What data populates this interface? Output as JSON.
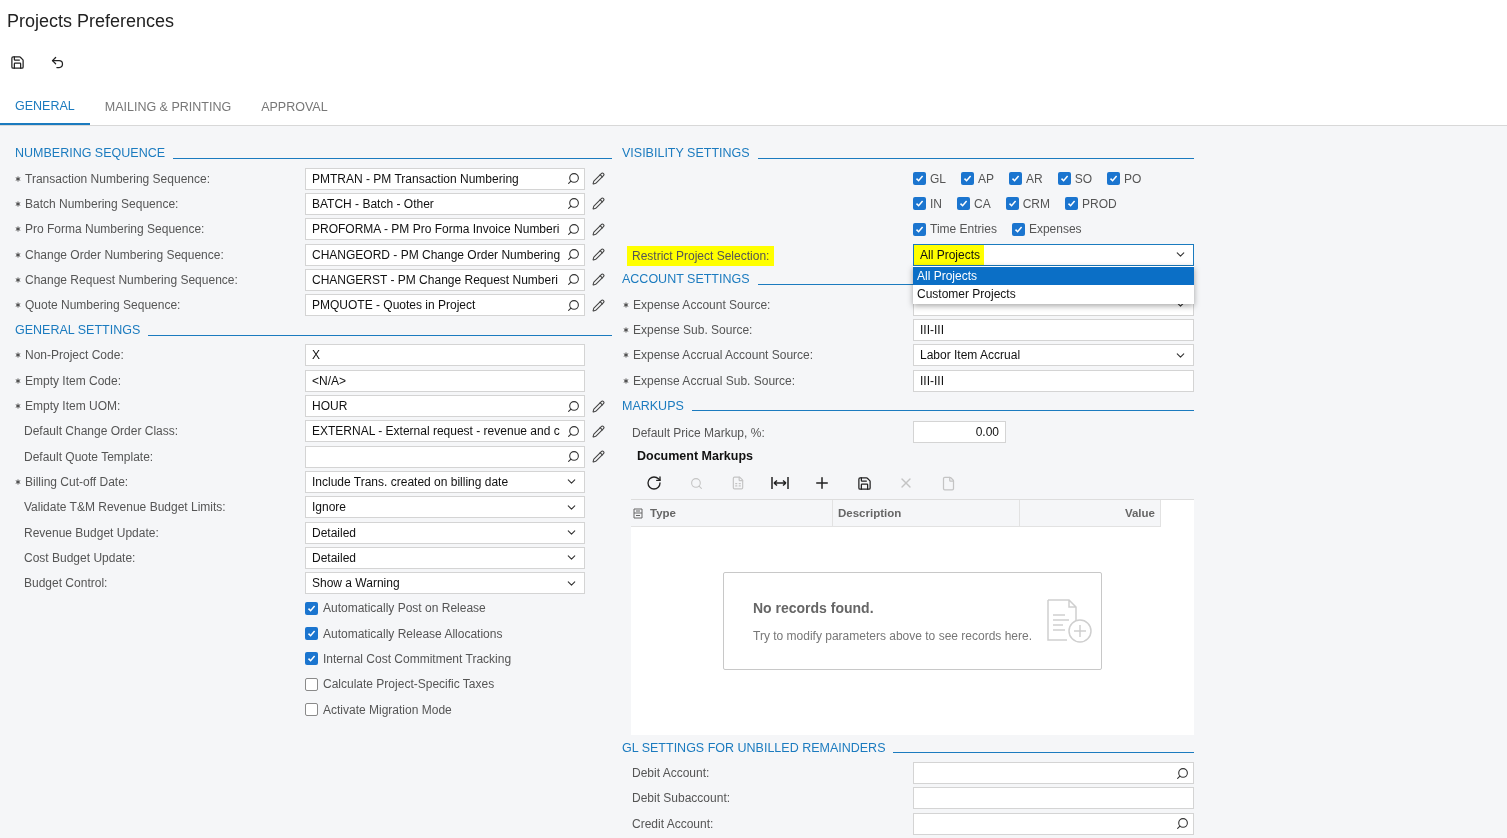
{
  "title": "Projects Preferences",
  "toolbar": [
    {
      "kind": "save"
    },
    {
      "kind": "undo"
    }
  ],
  "tabs": [
    {
      "label": "GENERAL",
      "selected": true
    },
    {
      "label": "MAILING & PRINTING",
      "selected": false
    },
    {
      "label": "APPROVAL",
      "selected": false
    }
  ],
  "left_sections": [
    {
      "title": "NUMBERING SEQUENCE",
      "rows": [
        {
          "kind": "lookup",
          "label": "Transaction Numbering Sequence:",
          "required": true,
          "value": "PMTRAN - PM Transaction Numbering",
          "editable": true
        },
        {
          "kind": "lookup",
          "label": "Batch Numbering Sequence:",
          "required": true,
          "value": "BATCH - Batch - Other",
          "editable": true
        },
        {
          "kind": "lookup",
          "label": "Pro Forma Numbering Sequence:",
          "required": true,
          "value": "PROFORMA - PM Pro Forma Invoice Numberi",
          "editable": true
        },
        {
          "kind": "lookup",
          "label": "Change Order Numbering Sequence:",
          "required": true,
          "value": "CHANGEORD - PM Change Order Numbering",
          "editable": true
        },
        {
          "kind": "lookup",
          "label": "Change Request Numbering Sequence:",
          "required": true,
          "value": "CHANGERST - PM Change Request Numberi",
          "editable": true
        },
        {
          "kind": "lookup",
          "label": "Quote Numbering Sequence:",
          "required": true,
          "value": "PMQUOTE - Quotes in Project",
          "editable": true
        }
      ]
    },
    {
      "title": "GENERAL SETTINGS",
      "rows": [
        {
          "kind": "text",
          "label": "Non-Project Code:",
          "required": true,
          "value": "X"
        },
        {
          "kind": "text",
          "label": "Empty Item Code:",
          "required": true,
          "value": "<N/A>"
        },
        {
          "kind": "lookup",
          "label": "Empty Item UOM:",
          "required": true,
          "value": "HOUR",
          "editable": true
        },
        {
          "kind": "lookup",
          "label": "Default Change Order Class:",
          "required": false,
          "value": "EXTERNAL - External request - revenue and c",
          "editable": true
        },
        {
          "kind": "lookup",
          "label": "Default Quote Template:",
          "required": false,
          "editable": true
        },
        {
          "kind": "select",
          "label": "Billing Cut-off Date:",
          "required": true,
          "value": "Include Trans. created on billing date"
        },
        {
          "kind": "select",
          "label": "Validate T&M Revenue Budget Limits:",
          "required": false,
          "value": "Ignore"
        },
        {
          "kind": "select",
          "label": "Revenue Budget Update:",
          "required": false,
          "value": "Detailed"
        },
        {
          "kind": "select",
          "label": "Cost Budget Update:",
          "required": false,
          "value": "Detailed"
        },
        {
          "kind": "select",
          "label": "Budget Control:",
          "required": false,
          "value": "Show a Warning"
        },
        {
          "kind": "checkbox",
          "label": "Automatically Post on Release",
          "checked": true
        },
        {
          "kind": "checkbox",
          "label": "Automatically Release Allocations",
          "checked": true
        },
        {
          "kind": "checkbox",
          "label": "Internal Cost Commitment Tracking",
          "checked": true
        },
        {
          "kind": "checkbox",
          "label": "Calculate Project-Specific Taxes",
          "checked": false
        },
        {
          "kind": "checkbox",
          "label": "Activate Migration Mode",
          "checked": false
        }
      ]
    }
  ],
  "visibility": {
    "title": "VISIBILITY SETTINGS",
    "checkbox_lines": [
      [
        {
          "label": "GL",
          "checked": true
        },
        {
          "label": "AP",
          "checked": true
        },
        {
          "label": "AR",
          "checked": true
        },
        {
          "label": "SO",
          "checked": true
        },
        {
          "label": "PO",
          "checked": true
        }
      ],
      [
        {
          "label": "IN",
          "checked": true
        },
        {
          "label": "CA",
          "checked": true
        },
        {
          "label": "CRM",
          "checked": true
        },
        {
          "label": "PROD",
          "checked": true
        }
      ],
      [
        {
          "label": "Time Entries",
          "checked": true
        },
        {
          "label": "Expenses",
          "checked": true
        }
      ]
    ],
    "restrict": {
      "label": "Restrict Project Selection:",
      "label_highlighted": true,
      "value": "All Projects",
      "value_highlighted": true,
      "open": true,
      "options": [
        {
          "label": "All Projects",
          "selected": true
        },
        {
          "label": "Customer Projects",
          "selected": false
        }
      ]
    }
  },
  "account_settings": {
    "title": "ACCOUNT SETTINGS",
    "rows": [
      {
        "kind": "select",
        "label": "Expense Account Source:",
        "required": true
      },
      {
        "kind": "text",
        "label": "Expense Sub. Source:",
        "required": true,
        "value": "III-III"
      },
      {
        "kind": "select",
        "label": "Expense Accrual Account Source:",
        "required": true,
        "value": "Labor Item Accrual"
      },
      {
        "kind": "text",
        "label": "Expense Accrual Sub. Source:",
        "required": true,
        "value": "III-III"
      }
    ]
  },
  "markups": {
    "title": "MARKUPS",
    "price_markup": {
      "label": "Default Price Markup, %:",
      "value": "0.00"
    },
    "grid": {
      "title": "Document Markups",
      "toolbar": [
        {
          "kind": "refresh",
          "disabled": false
        },
        {
          "kind": "search",
          "disabled": true
        },
        {
          "kind": "excel",
          "disabled": true
        },
        {
          "kind": "fit",
          "disabled": false
        },
        {
          "kind": "add",
          "disabled": false
        },
        {
          "kind": "save",
          "disabled": false
        },
        {
          "kind": "delete",
          "disabled": true
        },
        {
          "kind": "file",
          "disabled": true
        }
      ],
      "columns": [
        "Type",
        "Description",
        "Value"
      ],
      "empty_title": "No records found.",
      "empty_text": "Try to modify parameters above to see records here."
    }
  },
  "gl_settings": {
    "title": "GL SETTINGS FOR UNBILLED REMAINDERS",
    "rows": [
      {
        "kind": "lookup",
        "label": "Debit Account:",
        "required": false
      },
      {
        "kind": "text",
        "label": "Debit Subaccount:",
        "required": false
      },
      {
        "kind": "lookup",
        "label": "Credit Account:",
        "required": false
      }
    ]
  }
}
